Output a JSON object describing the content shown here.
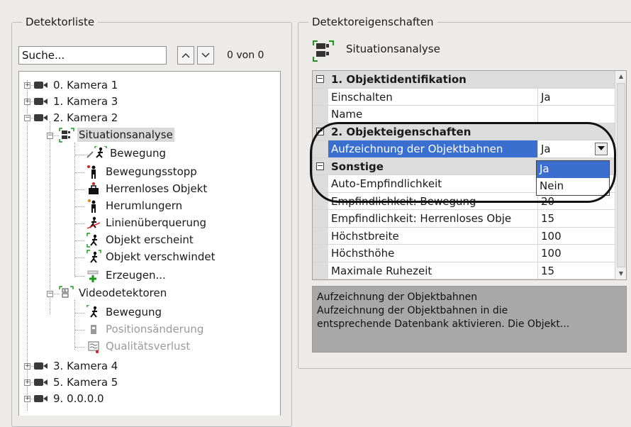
{
  "detector_list": {
    "legend": "Detektorliste",
    "search_placeholder": "Suche...",
    "counter": "0 von 0",
    "tree": [
      {
        "label": "0. Kamera 1"
      },
      {
        "label": "1. Kamera 3"
      },
      {
        "label": "2. Kamera 2"
      },
      {
        "label": "Situationsanalyse"
      },
      {
        "label": "Bewegung"
      },
      {
        "label": "Bewegungsstopp"
      },
      {
        "label": "Herrenloses Objekt"
      },
      {
        "label": "Herumlungern"
      },
      {
        "label": "Linienüberquerung"
      },
      {
        "label": "Objekt erscheint"
      },
      {
        "label": "Objekt verschwindet"
      },
      {
        "label": "Erzeugen..."
      },
      {
        "label": "Videodetektoren"
      },
      {
        "label": "Bewegung"
      },
      {
        "label": "Positionsänderung"
      },
      {
        "label": "Qualitätsverlust"
      },
      {
        "label": "3. Kamera 4"
      },
      {
        "label": "5. Kamera 5"
      },
      {
        "label": "9. 0.0.0.0"
      }
    ]
  },
  "properties": {
    "legend": "Detektoreigenschaften",
    "title": "Situationsanalyse",
    "rows": [
      {
        "name": "1. Objektidentifikation",
        "value": "",
        "type": "category"
      },
      {
        "name": "Einschalten",
        "value": "Ja"
      },
      {
        "name": "Name",
        "value": ""
      },
      {
        "name": "2. Objekteigenschaften",
        "value": "",
        "type": "category"
      },
      {
        "name": "Aufzeichnung der Objektbahnen",
        "value": "Ja"
      },
      {
        "name": "Sonstige",
        "value": "",
        "type": "category"
      },
      {
        "name": "Auto-Empfindlichkeit",
        "value": ""
      },
      {
        "name": "Empfindlichkeit: Bewegung",
        "value": "20"
      },
      {
        "name": "Empfindlichkeit: Herrenloses Obje",
        "value": "15"
      },
      {
        "name": "Höchstbreite",
        "value": "100"
      },
      {
        "name": "Höchsthöhe",
        "value": "100"
      },
      {
        "name": "Maximale Ruhezeit",
        "value": "15"
      }
    ],
    "dropdown_options": [
      "Ja",
      "Nein"
    ],
    "description": {
      "title": "Aufzeichnung der Objektbahnen",
      "line1": "Aufzeichnung der Objektbahnen in die",
      "line2": "entsprechende Datenbank aktivieren. Die Objekt..."
    }
  },
  "colors": {
    "selection_blue": "#3a6fd0",
    "accent_green": "#1a9a1a",
    "accent_red": "#d42020"
  }
}
